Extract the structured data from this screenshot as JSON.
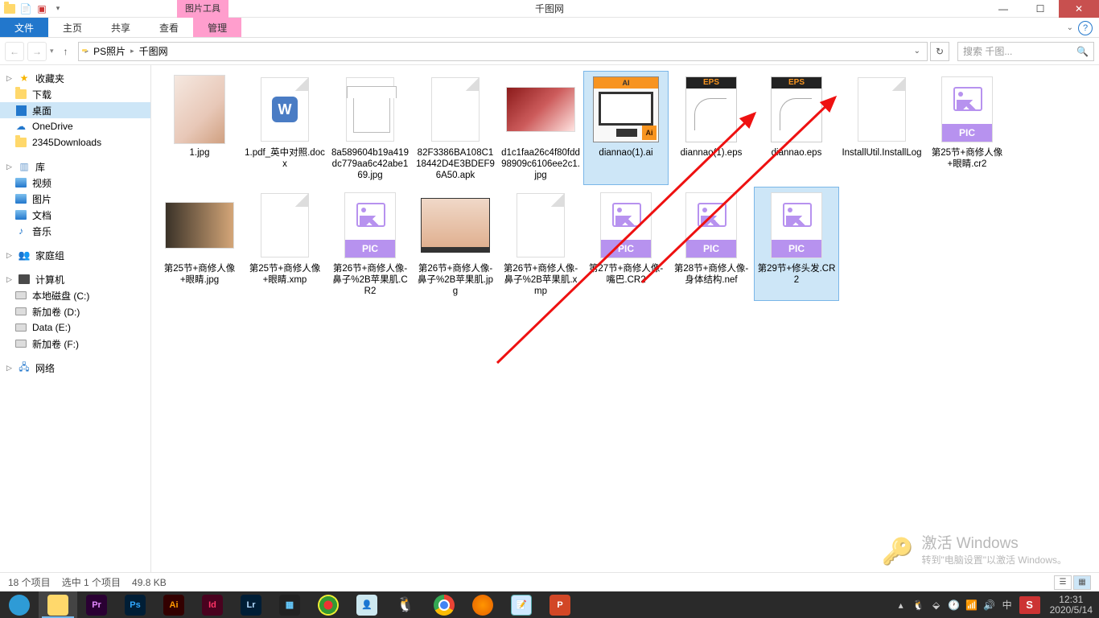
{
  "window": {
    "title": "千图网",
    "context_tab": "图片工具",
    "qat": [
      "folder-icon",
      "new-icon",
      "props-icon",
      "down-icon"
    ]
  },
  "ribbon": {
    "file": "文件",
    "tabs": [
      "主页",
      "共享",
      "查看"
    ],
    "ctx_tab": "管理"
  },
  "nav": {
    "crumbs": [
      "PS照片",
      "千图网"
    ],
    "search_placeholder": "搜索 千图..."
  },
  "sidebar": {
    "fav": {
      "label": "收藏夹",
      "items": [
        {
          "label": "下载",
          "icon": "folder"
        },
        {
          "label": "桌面",
          "icon": "desktop",
          "selected": true
        },
        {
          "label": "OneDrive",
          "icon": "cloud"
        },
        {
          "label": "2345Downloads",
          "icon": "folder"
        }
      ]
    },
    "lib": {
      "label": "库",
      "items": [
        {
          "label": "视频",
          "icon": "lib"
        },
        {
          "label": "图片",
          "icon": "lib"
        },
        {
          "label": "文档",
          "icon": "lib"
        },
        {
          "label": "音乐",
          "icon": "music"
        }
      ]
    },
    "home": {
      "label": "家庭组"
    },
    "pc": {
      "label": "计算机",
      "items": [
        {
          "label": "本地磁盘 (C:)",
          "icon": "disk"
        },
        {
          "label": "新加卷 (D:)",
          "icon": "disk"
        },
        {
          "label": "Data (E:)",
          "icon": "disk"
        },
        {
          "label": "新加卷 (F:)",
          "icon": "disk"
        }
      ]
    },
    "net": {
      "label": "网络"
    }
  },
  "files": [
    {
      "name": "1.jpg",
      "type": "img-portrait"
    },
    {
      "name": "1.pdf_英中对照.docx",
      "type": "wps"
    },
    {
      "name": "8a589604b19a419dc779aa6c42abe169.jpg",
      "type": "tshirt"
    },
    {
      "name": "82F3386BA108C118442D4E3BDEF96A50.apk",
      "type": "doc"
    },
    {
      "name": "d1c1faa26c4f80fdd98909c6106ee2c1.jpg",
      "type": "img-wide"
    },
    {
      "name": "diannao(1).ai",
      "type": "ai",
      "selected": true
    },
    {
      "name": "diannao(1).eps",
      "type": "eps"
    },
    {
      "name": "diannao.eps",
      "type": "eps"
    },
    {
      "name": "InstallUtil.InstallLog",
      "type": "doc"
    },
    {
      "name": "第25节+商修人像+眼睛.cr2",
      "type": "pic"
    },
    {
      "name": "第25节+商修人像+眼睛.jpg",
      "type": "img-face"
    },
    {
      "name": "第25节+商修人像+眼睛.xmp",
      "type": "doc"
    },
    {
      "name": "第26节+商修人像-鼻子%2B苹果肌.CR2",
      "type": "pic"
    },
    {
      "name": "第26节+商修人像-鼻子%2B苹果肌.jpg",
      "type": "double"
    },
    {
      "name": "第26节+商修人像-鼻子%2B苹果肌.xmp",
      "type": "doc"
    },
    {
      "name": "第27节+商修人像-嘴巴.CR2",
      "type": "pic"
    },
    {
      "name": "第28节+商修人像-身体结构.nef",
      "type": "pic"
    },
    {
      "name": "第29节+修头发.CR2",
      "type": "pic",
      "selected": true
    }
  ],
  "status": {
    "count": "18 个项目",
    "selection": "选中 1 个项目",
    "size": "49.8 KB"
  },
  "watermark": {
    "title": "激活 Windows",
    "sub": "转到\"电脑设置\"以激活 Windows。"
  },
  "tray": {
    "time": "12:31",
    "date": "2020/5/14"
  }
}
